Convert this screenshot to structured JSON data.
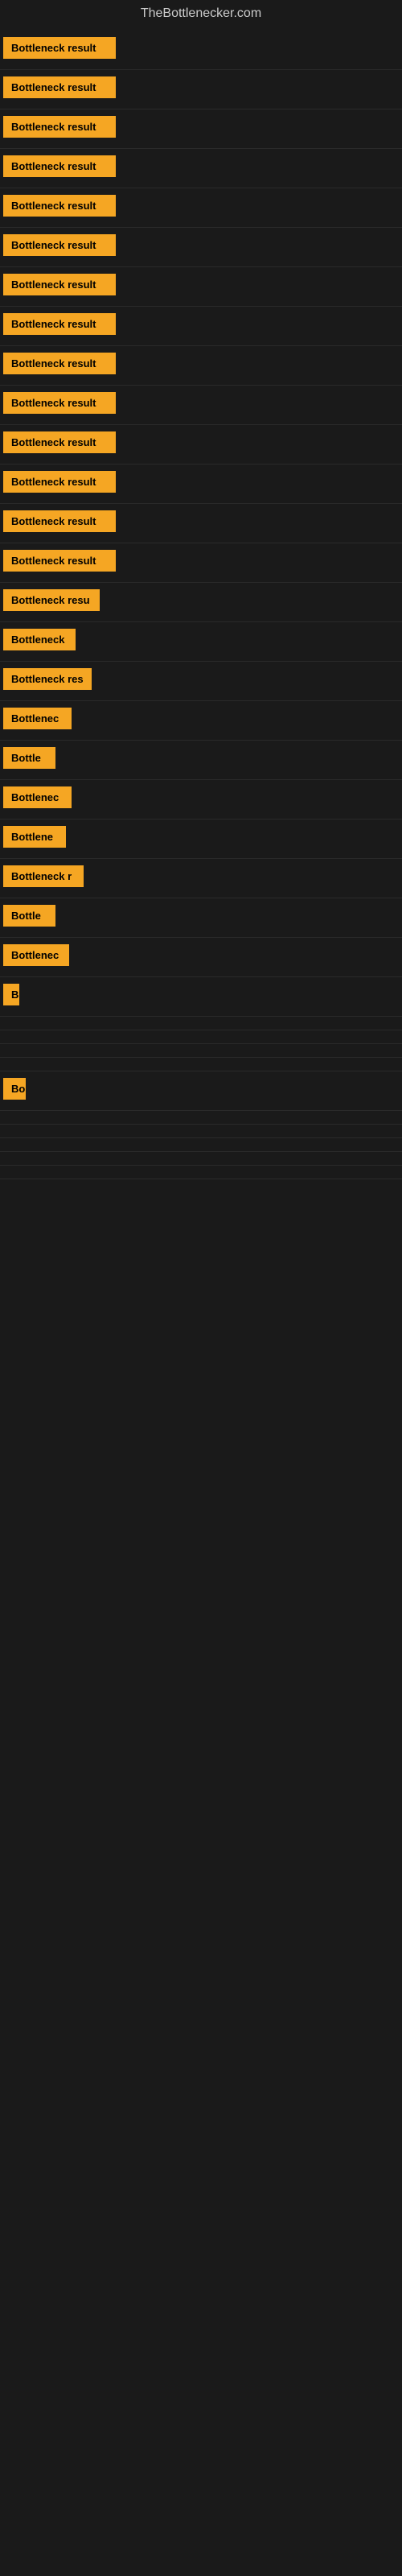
{
  "site": {
    "title": "TheBottlenecker.com"
  },
  "rows": [
    {
      "label": "Bottleneck result",
      "width": 140
    },
    {
      "label": "Bottleneck result",
      "width": 140
    },
    {
      "label": "Bottleneck result",
      "width": 140
    },
    {
      "label": "Bottleneck result",
      "width": 140
    },
    {
      "label": "Bottleneck result",
      "width": 140
    },
    {
      "label": "Bottleneck result",
      "width": 140
    },
    {
      "label": "Bottleneck result",
      "width": 140
    },
    {
      "label": "Bottleneck result",
      "width": 140
    },
    {
      "label": "Bottleneck result",
      "width": 140
    },
    {
      "label": "Bottleneck result",
      "width": 140
    },
    {
      "label": "Bottleneck result",
      "width": 140
    },
    {
      "label": "Bottleneck result",
      "width": 140
    },
    {
      "label": "Bottleneck result",
      "width": 140
    },
    {
      "label": "Bottleneck result",
      "width": 140
    },
    {
      "label": "Bottleneck resu",
      "width": 120
    },
    {
      "label": "Bottleneck",
      "width": 90
    },
    {
      "label": "Bottleneck res",
      "width": 110
    },
    {
      "label": "Bottlenec",
      "width": 85
    },
    {
      "label": "Bottle",
      "width": 65
    },
    {
      "label": "Bottlenec",
      "width": 85
    },
    {
      "label": "Bottlene",
      "width": 78
    },
    {
      "label": "Bottleneck r",
      "width": 100
    },
    {
      "label": "Bottle",
      "width": 65
    },
    {
      "label": "Bottlenec",
      "width": 82
    },
    {
      "label": "B",
      "width": 18
    },
    {
      "label": "",
      "width": 0
    },
    {
      "label": "",
      "width": 0
    },
    {
      "label": "",
      "width": 0
    },
    {
      "label": "",
      "width": 0
    },
    {
      "label": "Bo",
      "width": 28
    },
    {
      "label": "",
      "width": 0
    },
    {
      "label": "",
      "width": 0
    },
    {
      "label": "",
      "width": 0
    },
    {
      "label": "",
      "width": 0
    },
    {
      "label": "",
      "width": 0
    }
  ]
}
